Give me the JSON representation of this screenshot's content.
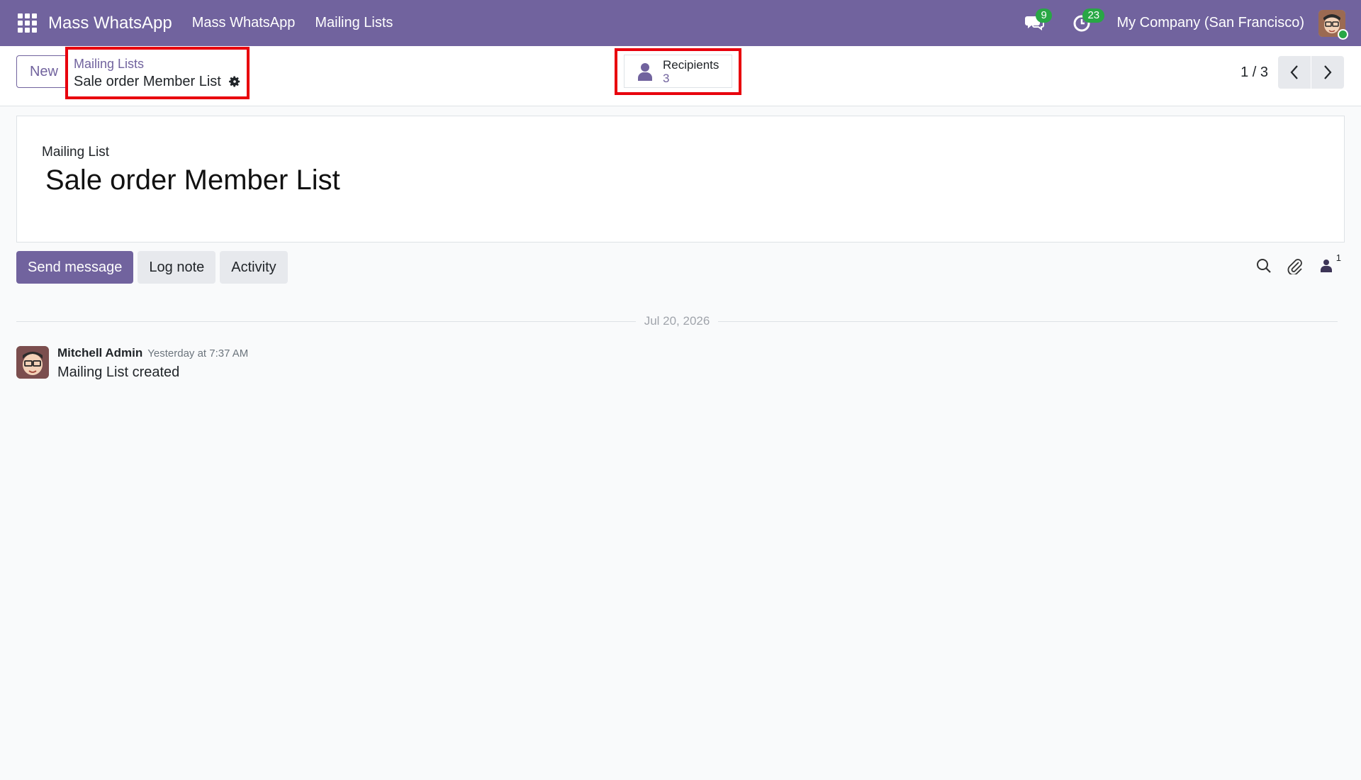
{
  "navbar": {
    "app_name": "Mass WhatsApp",
    "menu": [
      {
        "label": "Mass WhatsApp"
      },
      {
        "label": "Mailing Lists"
      }
    ],
    "messages_badge": "9",
    "activities_badge": "23",
    "company": "My Company (San Francisco)"
  },
  "control_panel": {
    "new_label": "New",
    "breadcrumb_parent": "Mailing Lists",
    "breadcrumb_current": "Sale order Member List",
    "recipients_label": "Recipients",
    "recipients_count": "3",
    "pager": "1 / 3"
  },
  "form": {
    "field_label": "Mailing List",
    "title": "Sale order Member List"
  },
  "chatter": {
    "send_message": "Send message",
    "log_note": "Log note",
    "activity": "Activity",
    "followers_count": "1",
    "date_separator": "Jul 20, 2026",
    "messages": [
      {
        "author": "Mitchell Admin",
        "date": "Yesterday at 7:37 AM",
        "body": "Mailing List created"
      }
    ]
  },
  "colors": {
    "brand": "#71639e",
    "highlight": "#e8000d",
    "badge": "#28a745"
  }
}
